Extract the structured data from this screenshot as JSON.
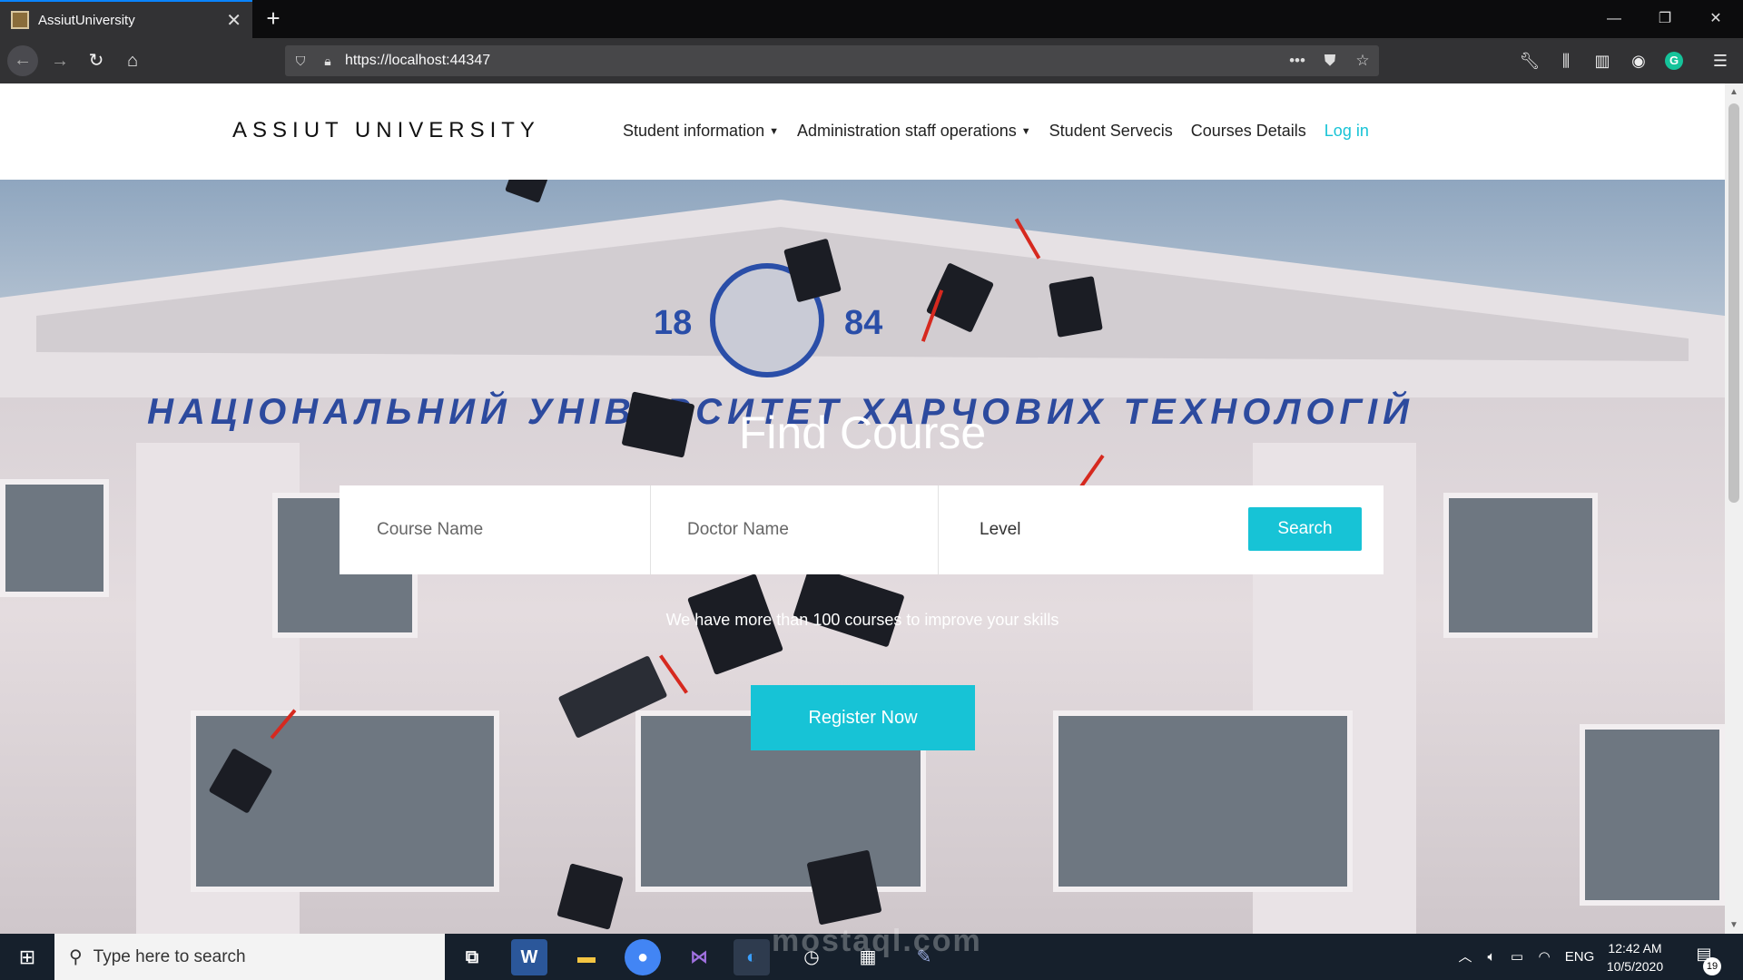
{
  "browser": {
    "tab_title": "AssiutUniversity",
    "tab_close": "✕",
    "new_tab": "+",
    "url": "https://localhost:44347",
    "window_controls": {
      "minimize": "—",
      "restore": "❐",
      "close": "✕"
    },
    "icons": [
      "back-icon",
      "forward-icon",
      "reload-icon",
      "home-icon",
      "shield-icon",
      "lock-icon",
      "more-icon",
      "pocket-icon",
      "bookmark-star-icon",
      "wrench-icon",
      "library-icon",
      "sidebar-icon",
      "account-icon",
      "grammarly-icon",
      "hamburger-menu-icon"
    ]
  },
  "site": {
    "brand": "ASSIUT UNIVERSITY",
    "menu": {
      "student_information": "Student information",
      "admin_operations": "Administration staff operations",
      "student_services": "Student Servecis",
      "courses_details": "Courses Details",
      "login": "Log in"
    },
    "hero": {
      "title": "Find Course",
      "subtitle": "We have more than 100 courses to improve your skills",
      "register_label": "Register Now",
      "building_sign": "НАЦІОНАЛЬНИЙ УНІВЕРСИТЕТ ХАРЧОВИХ ТЕХНОЛОГІЙ",
      "year_left": "18",
      "year_right": "84"
    },
    "search": {
      "course_placeholder": "Course Name",
      "doctor_placeholder": "Doctor Name",
      "level_label": "Level",
      "search_label": "Search"
    },
    "accent_color": "#17c3d6"
  },
  "taskbar": {
    "search_placeholder": "Type here to search",
    "apps": [
      "task-view-icon",
      "word-icon",
      "file-explorer-icon",
      "chrome-icon",
      "visual-studio-icon",
      "firefox-icon",
      "clock-app-icon",
      "calendar-app-icon",
      "paint-icon"
    ],
    "language": "ENG",
    "time": "12:42 AM",
    "date": "10/5/2020",
    "notification_count": "19",
    "watermark": "mostaql.com"
  }
}
